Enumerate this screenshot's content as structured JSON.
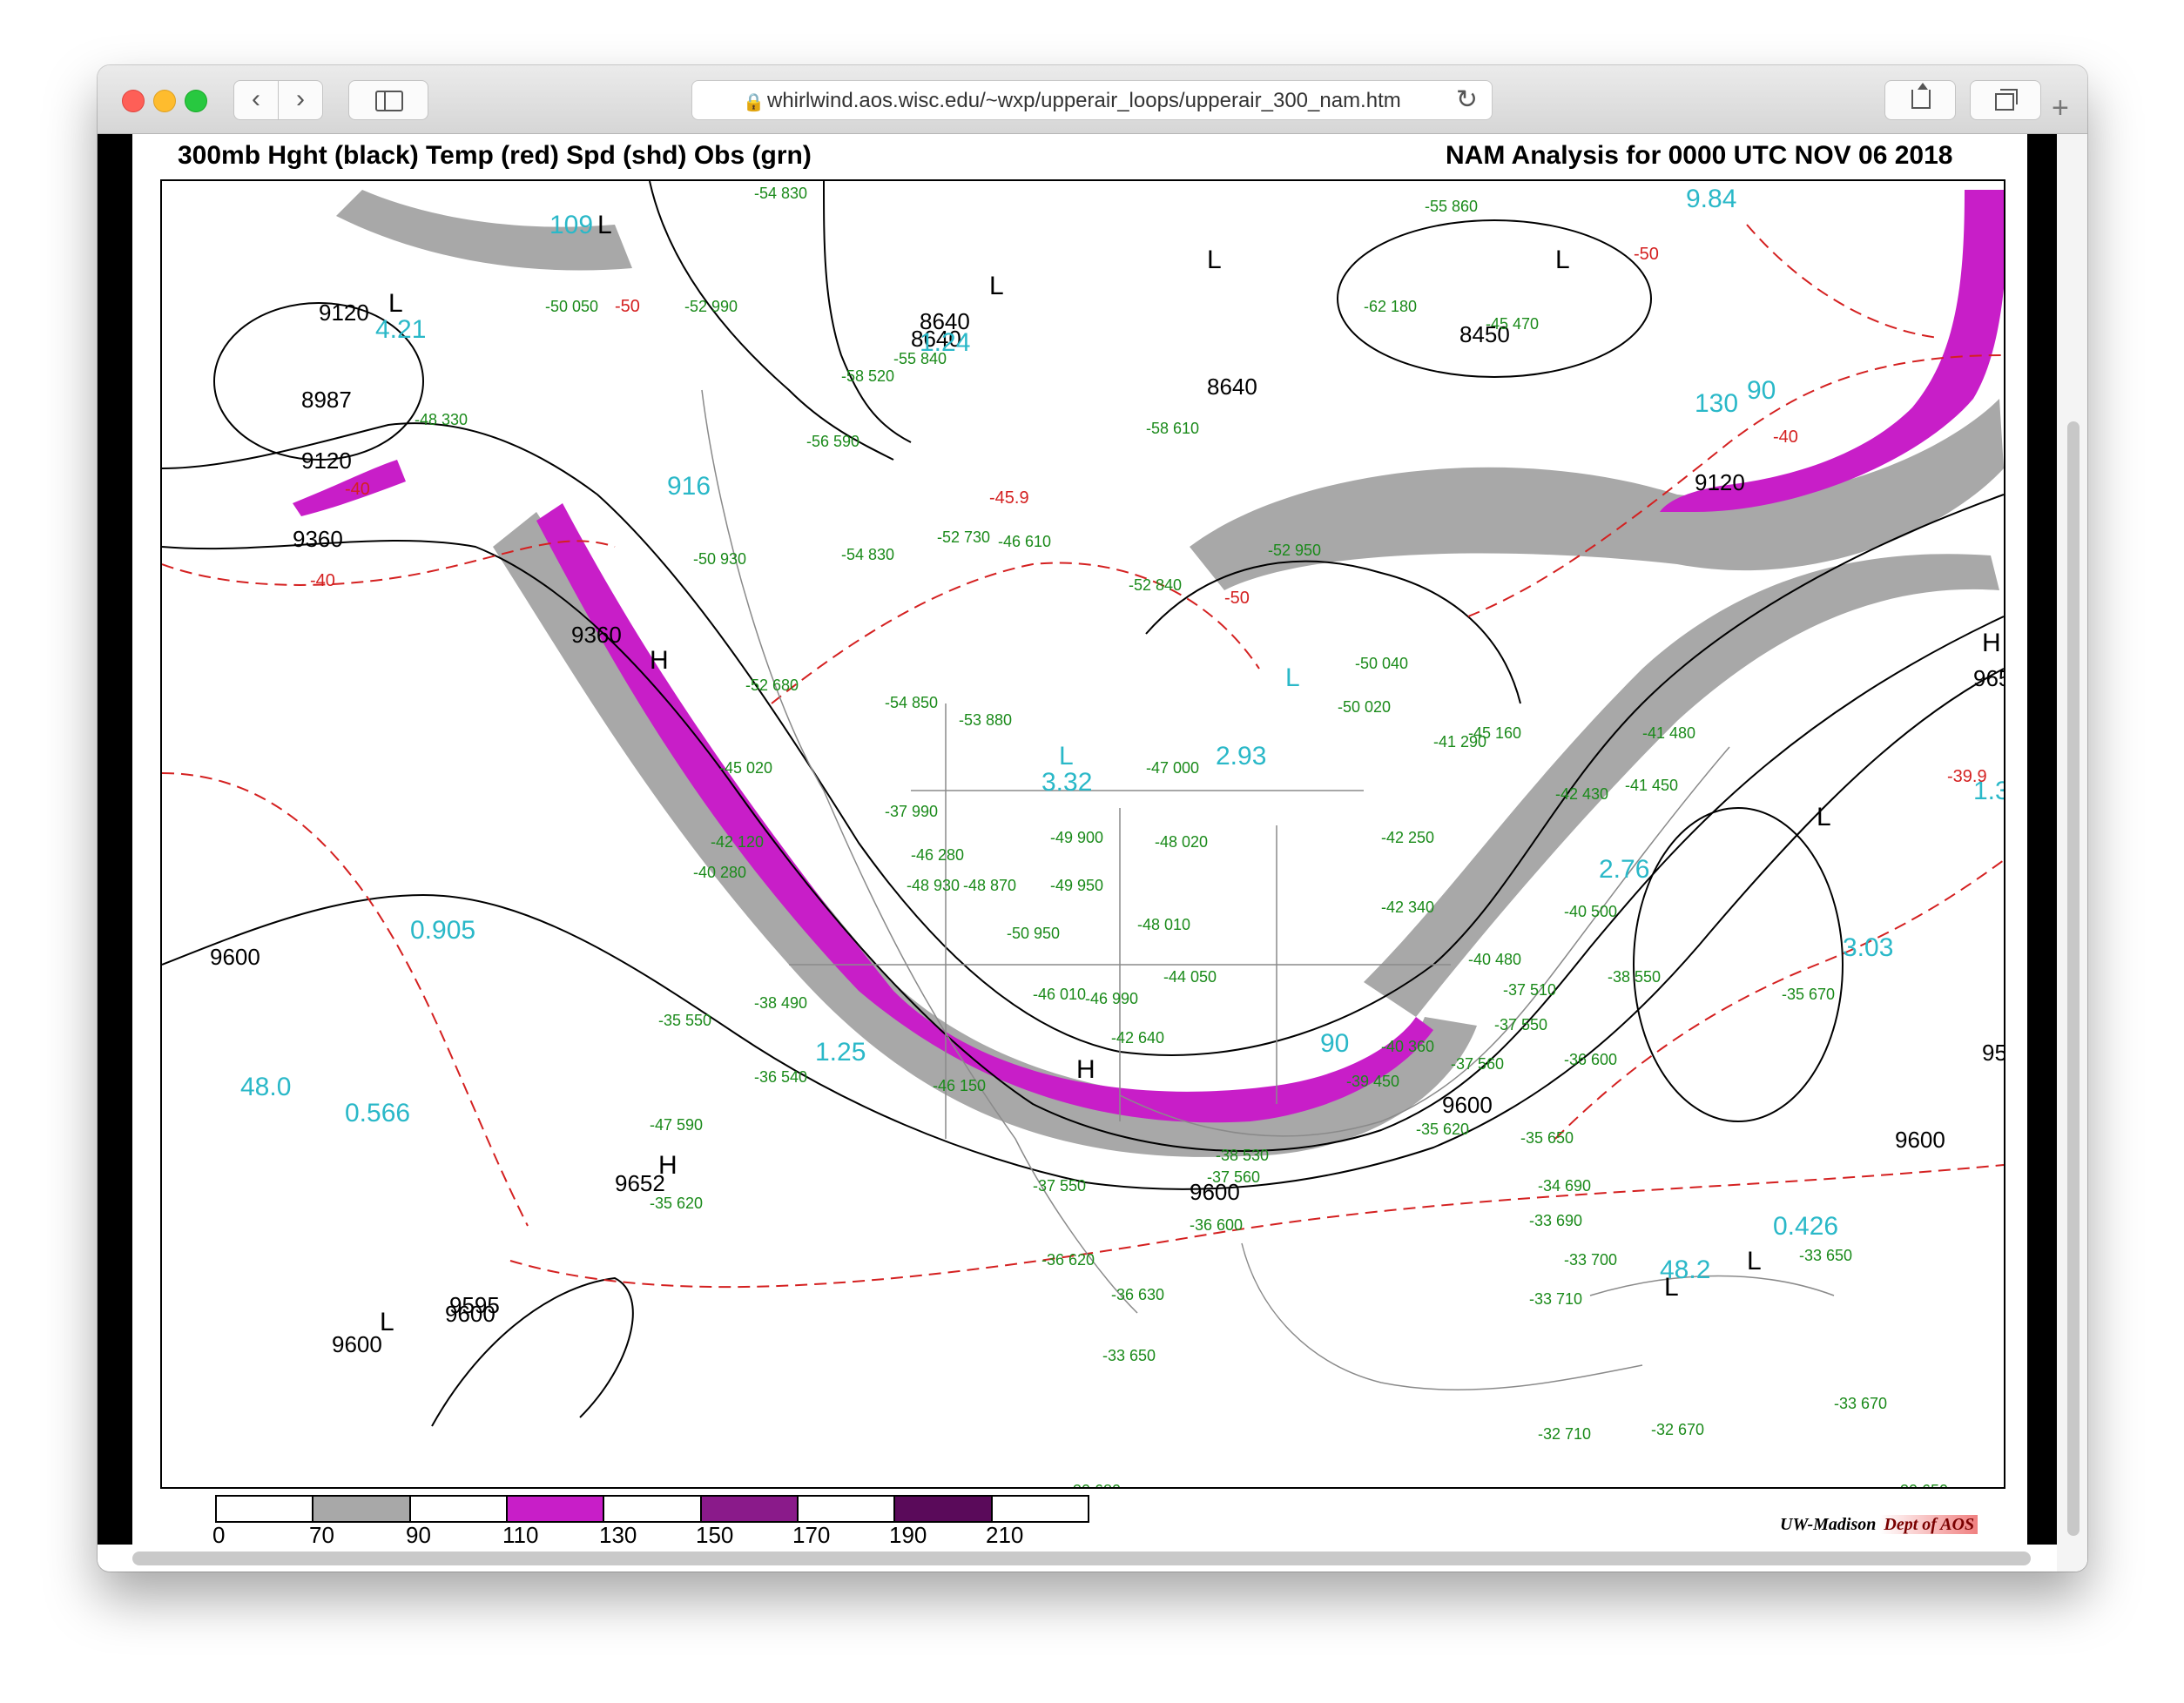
{
  "browser": {
    "url": "whirlwind.aos.wisc.edu/~wxp/upperair_loops/upperair_300_nam.htm",
    "back_glyph": "‹",
    "forward_glyph": "›",
    "reload_glyph": "↻",
    "lock_glyph": "🔒",
    "newtab_glyph": "+"
  },
  "map": {
    "title_left": "300mb Hght (black) Temp (red) Spd (shd) Obs (grn)",
    "title_right": "NAM Analysis for 0000 UTC  NOV 06 2018",
    "colors": {
      "height_contour": "#000000",
      "temp_contour": "#d42020",
      "speed_70_90": "#a8a8a8",
      "speed_110_130": "#c81ec8",
      "obs": "#1a8a1a",
      "cyan_labels": "#2ab8c8"
    },
    "height_labels": [
      {
        "text": "9120"
      },
      {
        "text": "8987"
      },
      {
        "text": "9120"
      },
      {
        "text": "9360"
      },
      {
        "text": "9360"
      },
      {
        "text": "8640"
      },
      {
        "text": "8640"
      },
      {
        "text": "8640"
      },
      {
        "text": "8450"
      },
      {
        "text": "9120"
      },
      {
        "text": "9652"
      },
      {
        "text": "9600"
      },
      {
        "text": "9652"
      },
      {
        "text": "9595"
      },
      {
        "text": "9600"
      },
      {
        "text": "9600"
      },
      {
        "text": "9600"
      },
      {
        "text": "9600"
      },
      {
        "text": "9600"
      },
      {
        "text": "95"
      }
    ],
    "system_markers": [
      {
        "letter": "L"
      },
      {
        "letter": "L"
      },
      {
        "letter": "L"
      },
      {
        "letter": "L"
      },
      {
        "letter": "L"
      },
      {
        "letter": "H"
      },
      {
        "letter": "H"
      },
      {
        "letter": "H"
      },
      {
        "letter": "L"
      },
      {
        "letter": "L"
      },
      {
        "letter": "H"
      },
      {
        "letter": "L"
      },
      {
        "letter": "L"
      },
      {
        "letter": "L"
      },
      {
        "letter": "L"
      }
    ],
    "cyan_values": [
      "4.21",
      "109",
      "1.24",
      "9.84",
      "90",
      "2.93",
      "3.32",
      "916",
      "0.905",
      "1.25",
      "48.0",
      "0.566",
      "48.2",
      "0.426",
      "2.76",
      "3.03",
      "1.3",
      "130",
      "90"
    ],
    "temp_labels": [
      "-40",
      "-40",
      "-50",
      "-50",
      "-40",
      "-45.9",
      "-50",
      "-39.9"
    ],
    "obs_labels": [
      "-54 830",
      "-52 990",
      "-50 050",
      "-48 330",
      "-50 930",
      "-55 840",
      "-56 590",
      "-58 520",
      "-58 610",
      "-62 180",
      "-55 860",
      "-45 470",
      "-52 950",
      "-52 840",
      "-46 610",
      "-54 830",
      "-52 730",
      "-52 680",
      "-54 850",
      "-53 880",
      "-50 040",
      "-50 020",
      "-47 000",
      "-48 020",
      "-48 010",
      "-49 900",
      "-49 950",
      "-50 950",
      "-46 010",
      "-46 990",
      "-44 050",
      "-42 640",
      "-41 480",
      "-41 450",
      "-42 430",
      "-42 250",
      "-42 340",
      "-40 480",
      "-40 500",
      "-38 550",
      "-37 510",
      "-37 550",
      "-36 600",
      "-37 560",
      "-35 620",
      "-35 650",
      "-34 690",
      "-33 690",
      "-33 700",
      "-33 710",
      "-33 650",
      "-35 670",
      "-32 710",
      "-32 670",
      "-30 650",
      "-30 680",
      "-36 630",
      "-33 650",
      "-36 620",
      "-37 550",
      "-36 600",
      "-47 590",
      "-35 620",
      "-38 490",
      "-35 550",
      "-36 540",
      "-40 280",
      "-42 120",
      "-45 020",
      "-37 990",
      "-48 930",
      "-48 870",
      "-46 150",
      "-46 280",
      "-45 160",
      "-41 290",
      "-40 360",
      "-39 450",
      "-38 530",
      "-37 560",
      "-33 670"
    ],
    "legend": {
      "colors": [
        "#ffffff",
        "#a8a8a8",
        "#ffffff",
        "#c81ec8",
        "#ffffff",
        "#8a1a8a",
        "#ffffff",
        "#5a0a5a",
        "#ffffff"
      ],
      "labels": [
        "0",
        "70",
        "90",
        "110",
        "130",
        "150",
        "170",
        "190",
        "210"
      ]
    },
    "credit_left": "UW-Madison",
    "credit_right": "Dept of AOS"
  }
}
